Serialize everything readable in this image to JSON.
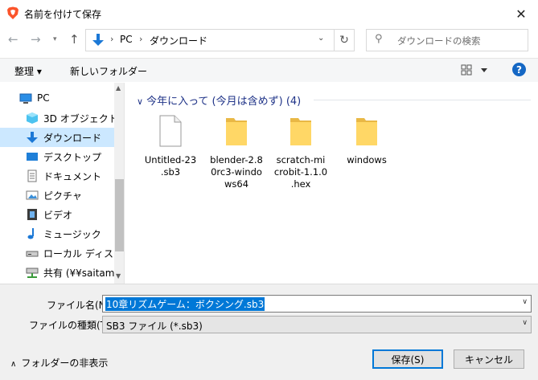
{
  "window": {
    "title": "名前を付けて保存",
    "close_glyph": "✕"
  },
  "nav": {
    "address": {
      "segments": [
        "PC",
        "ダウンロード"
      ]
    },
    "search_placeholder": "ダウンロードの検索"
  },
  "toolbar": {
    "organize_label": "整理 ▾",
    "new_folder_label": "新しいフォルダー",
    "help_label": "?"
  },
  "sidebar": {
    "items": [
      {
        "label": "PC",
        "icon": "pc-icon"
      },
      {
        "label": "3D オブジェクト",
        "icon": "3d-objects-icon"
      },
      {
        "label": "ダウンロード",
        "icon": "download-icon",
        "selected": true
      },
      {
        "label": "デスクトップ",
        "icon": "desktop-icon"
      },
      {
        "label": "ドキュメント",
        "icon": "documents-icon"
      },
      {
        "label": "ピクチャ",
        "icon": "pictures-icon"
      },
      {
        "label": "ビデオ",
        "icon": "video-icon"
      },
      {
        "label": "ミュージック",
        "icon": "music-icon"
      },
      {
        "label": "ローカル ディスク (C",
        "icon": "local-disk-icon"
      },
      {
        "label": "共有 (¥¥saitama_",
        "icon": "network-drive-icon"
      }
    ]
  },
  "main": {
    "group_header": "今年に入って (今月は含めず) (4)",
    "files": [
      {
        "name": "Untitled-23.sb3",
        "lines": [
          "Untitled-23",
          ".sb3"
        ],
        "type": "file"
      },
      {
        "name": "blender-2.80rc3-windows64",
        "lines": [
          "blender-2.8",
          "0rc3-windo",
          "ws64"
        ],
        "type": "folder"
      },
      {
        "name": "scratch-microbit-1.1.0.hex",
        "lines": [
          "scratch-mi",
          "crobit-1.1.0",
          ".hex"
        ],
        "type": "folder"
      },
      {
        "name": "windows",
        "lines": [
          "windows"
        ],
        "type": "folder"
      }
    ]
  },
  "bottom": {
    "filename_label": "ファイル名(N):",
    "filename_value": "10章リズムゲーム：ボクシング.sb3",
    "filetype_label": "ファイルの種類(T):",
    "filetype_value": "SB3 ファイル (*.sb3)",
    "hide_folders_label": "フォルダーの非表示",
    "save_label": "保存(S)",
    "cancel_label": "キャンセル"
  },
  "colors": {
    "accent": "#0078d7",
    "selected_bg": "#cce8ff",
    "brave_orange": "#fb542b",
    "folder_yellow": "#ffd766",
    "group_header": "#1e3287"
  }
}
